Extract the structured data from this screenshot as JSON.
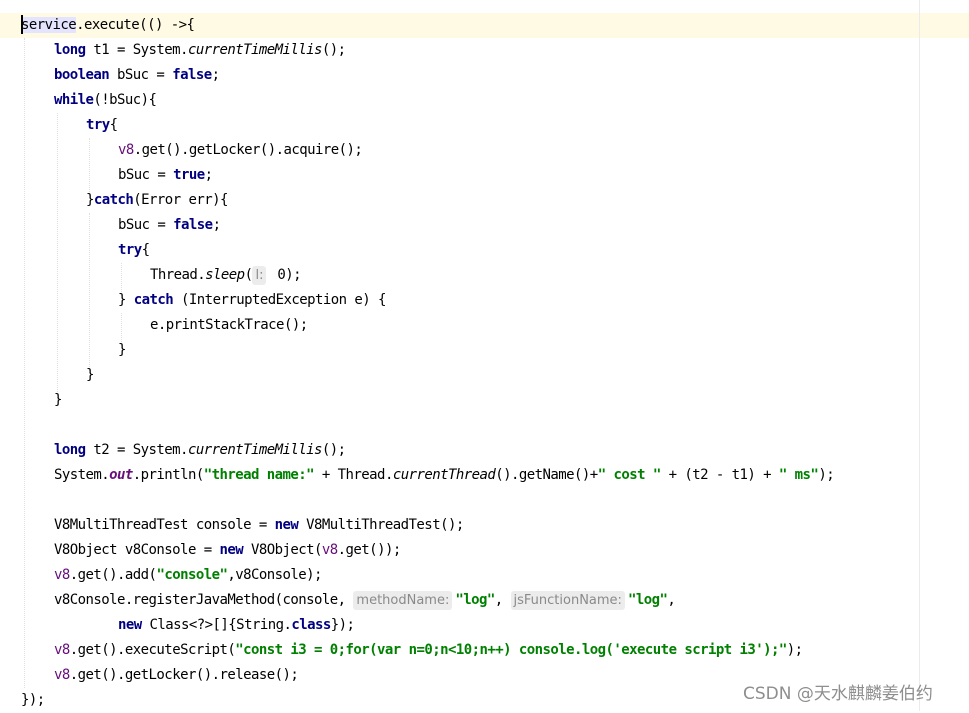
{
  "code": {
    "l1_a": "service",
    "l1_b": ".execute(() ->{",
    "kw_long": "long",
    "kw_boolean": "boolean",
    "kw_while": "while",
    "kw_try": "try",
    "kw_catch": "catch",
    "kw_true": "true",
    "kw_false": "false",
    "kw_new": "new",
    "kw_class": "class",
    "l2_b": " t1 = System.",
    "currentTimeMillis": "currentTimeMillis",
    "l2_d": "();",
    "l3_b": " bSuc = ",
    "semi": ";",
    "l4_b": "(!bSuc){",
    "brace_open": "{",
    "v8": "v8",
    "l6_b": ".get().getLocker().acquire();",
    "l7_a": "bSuc = ",
    "l8_a": "}",
    "l8_b": "(Error err){",
    "l11_a": "Thread.",
    "sleep": "sleep",
    "paren_open": "(",
    "hint_l": "l:",
    "l11_c": " 0);",
    "l12_a": "} ",
    "l12_b": " (InterruptedException e) {",
    "l13_a": "e.printStackTrace();",
    "close_brace": "}",
    "l17_b": " t2 = System.",
    "l18_a": "System.",
    "out": "out",
    "l18_b": ".println(",
    "str_thread_name": "\"thread name:\"",
    "l18_c": " + Thread.",
    "currentThread": "currentThread",
    "l18_d": "().getName()+",
    "str_cost": "\" cost \"",
    "l18_e": " + (t2 - t1) + ",
    "str_ms": "\" ms\"",
    "l18_f": ");",
    "l20_a": "V8MultiThreadTest console = ",
    "l20_b": " V8MultiThreadTest();",
    "l21_a": "V8Object v8Console = ",
    "l21_b": " V8Object(",
    "l21_c": ".get());",
    "l22_b": ".get().add(",
    "str_console": "\"console\"",
    "l22_c": ",v8Console);",
    "l23_a": "v8Console.registerJavaMethod(console, ",
    "hint_methodName": "methodName:",
    "str_log": "\"log\"",
    "comma": ", ",
    "hint_jsFunctionName": "jsFunctionName:",
    "comma_end": ",",
    "l24_b": " Class<?>[]{String.",
    "l24_c": "});",
    "l25_b": ".get().executeScript(",
    "str_script": "\"const i3 = 0;for(var n=0;n<10;n++) console.log('execute script i3');\"",
    "l26_b": ".get().getLocker().release();",
    "l27": "});"
  },
  "watermark": "CSDN @天水麒麟姜伯约"
}
